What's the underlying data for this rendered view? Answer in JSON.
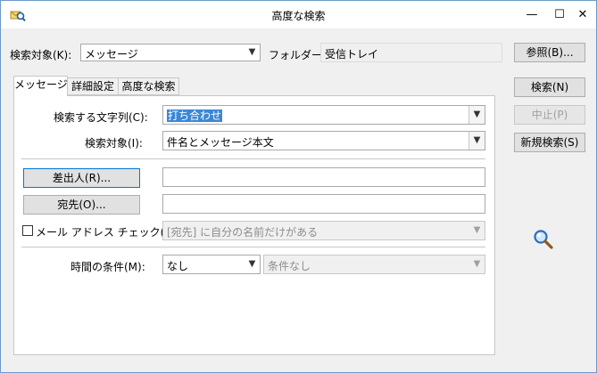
{
  "window": {
    "title": "高度な検索",
    "minimize": "—",
    "maximize": "☐",
    "close": "✕"
  },
  "top": {
    "look_for_label": "検索対象(K):",
    "look_for_value": "メッセージ",
    "folder_label": "フォルダー:",
    "folder_value": "受信トレイ",
    "browse_label": "参照(B)..."
  },
  "tabs": [
    "メッセージ",
    "詳細設定",
    "高度な検索"
  ],
  "side_buttons": {
    "find_now": "検索(N)",
    "stop": "中止(P)",
    "new_search": "新規検索(S)"
  },
  "form": {
    "search_text_label": "検索する文字列(C):",
    "search_text_value": "打ち合わせ",
    "in_label": "検索対象(I):",
    "in_value": "件名とメッセージ本文",
    "from_button": "差出人(R)...",
    "from_value": "",
    "sent_to_button": "宛先(O)...",
    "sent_to_value": "",
    "where_checkbox_label": "メール アドレス チェック(W):",
    "where_checkbox_checked": false,
    "where_value": "[宛先] に自分の名前だけがある",
    "time_label": "時間の条件(M):",
    "time_value": "なし",
    "time_condition_value": "条件なし"
  },
  "icons": {
    "app": "search-envelope-icon",
    "search_anim": "magnifier-icon"
  },
  "colors": {
    "selection": "#3b87d6",
    "focus_border": "#0078d7",
    "window_border": "#6b9ac8"
  }
}
